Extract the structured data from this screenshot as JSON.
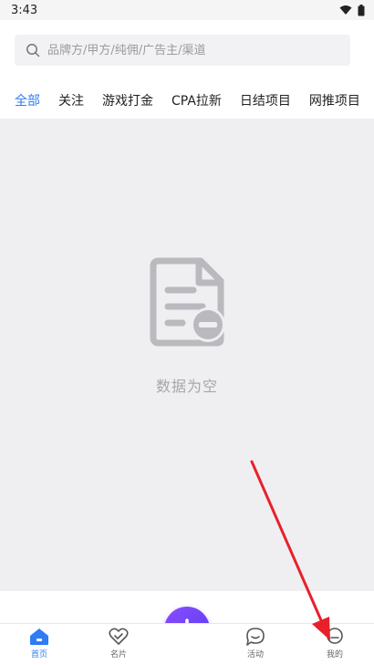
{
  "status_bar": {
    "time": "3:43"
  },
  "search": {
    "placeholder": "品牌方/甲方/纯佣/广告主/渠道"
  },
  "tabs": [
    {
      "label": "全部"
    },
    {
      "label": "关注"
    },
    {
      "label": "游戏打金"
    },
    {
      "label": "CPA拉新"
    },
    {
      "label": "日结项目"
    },
    {
      "label": "网推项目"
    }
  ],
  "empty_state": {
    "text": "数据为空"
  },
  "bottom_nav": {
    "items": [
      {
        "label": "首页"
      },
      {
        "label": "名片"
      },
      {
        "label": "活动"
      },
      {
        "label": "我的"
      }
    ]
  },
  "colors": {
    "accent": "#2e7cf6",
    "fab": "#6a3ff5",
    "arrow": "#e8202a"
  }
}
